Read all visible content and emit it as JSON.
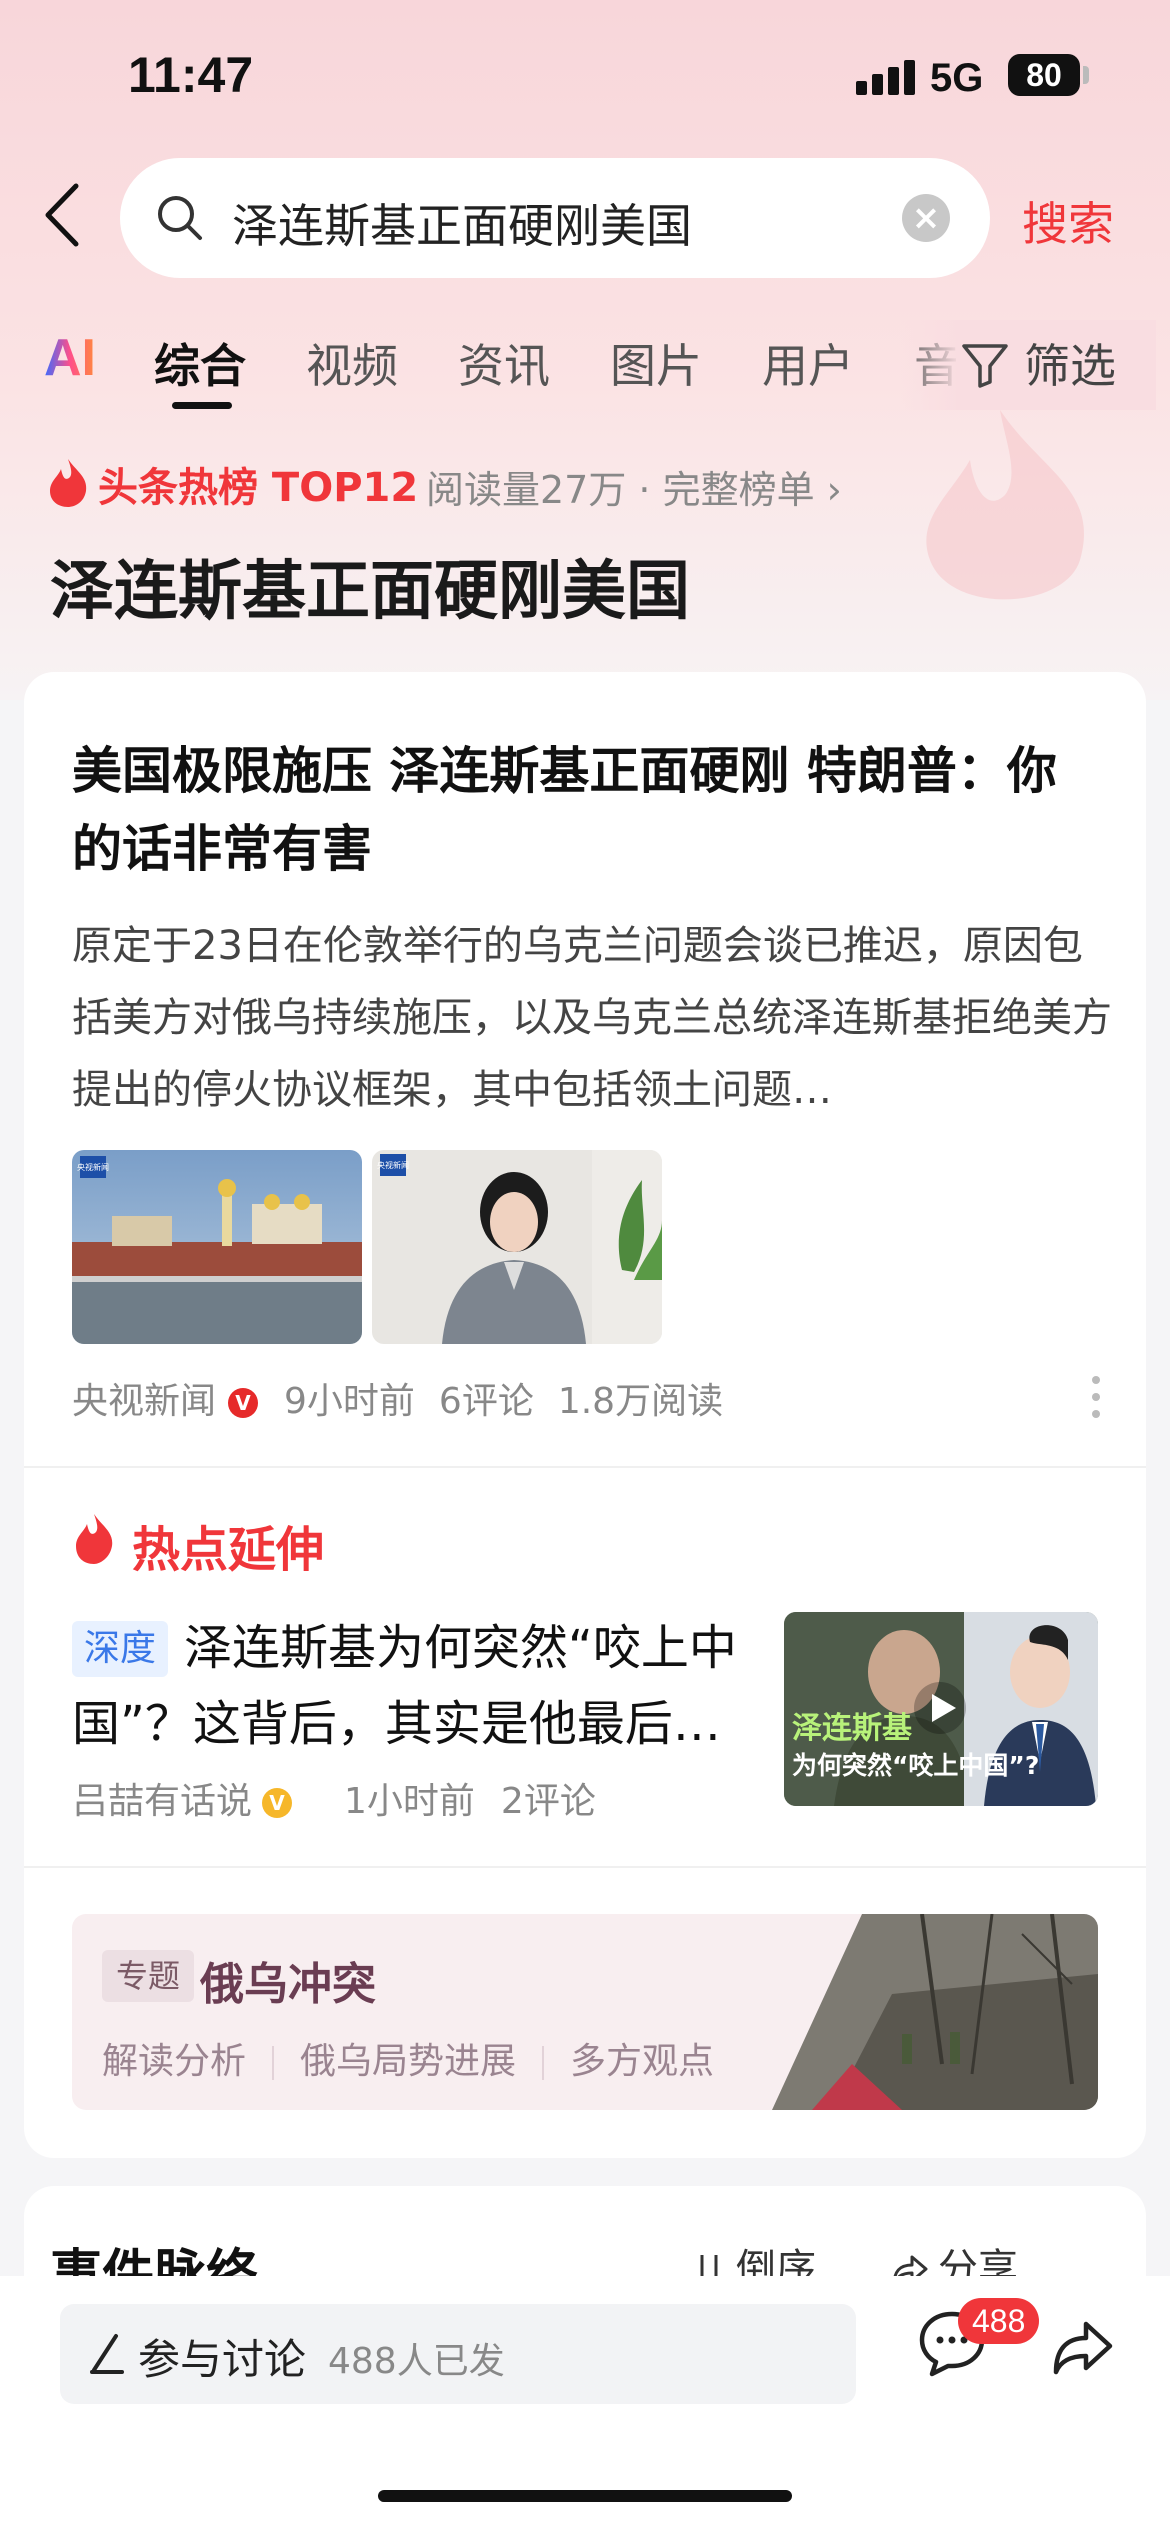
{
  "status_bar": {
    "time": "11:47",
    "network": "5G",
    "battery": "80"
  },
  "search": {
    "query": "泽连斯基正面硬刚美国",
    "button_label": "搜索"
  },
  "tabs": {
    "ai_label": "AI",
    "items": [
      {
        "label": "综合"
      },
      {
        "label": "视频"
      },
      {
        "label": "资讯"
      },
      {
        "label": "图片"
      },
      {
        "label": "用户"
      },
      {
        "label": "音"
      }
    ],
    "filter_label": "筛选"
  },
  "hot": {
    "badge": "头条热榜 TOP12",
    "meta": "阅读量27万 · 完整榜单 ›",
    "topic": "泽连斯基正面硬刚美国"
  },
  "article": {
    "title": "美国极限施压 泽连斯基正面硬刚 特朗普：你的话非常有害",
    "summary": "原定于23日在伦敦举行的乌克兰问题会谈已推迟，原因包括美方对俄乌持续施压，以及乌克兰总统泽连斯基拒绝美方提出的停火协议框架，其中包括领土问题…",
    "source": "央视新闻",
    "verified_mark": "V",
    "time": "9小时前",
    "comments": "6评论",
    "reads": "1.8万阅读",
    "thumb_logo": "央视新闻"
  },
  "extension": {
    "title": "热点延伸",
    "item": {
      "tag": "深度",
      "title": "泽连斯基为何突然“咬上中国”？这背后，其实是他最后…",
      "author": "吕喆有话说",
      "verified_mark": "V",
      "time": "1小时前",
      "comments": "2评论",
      "thumb_text_1": "泽连斯基",
      "thumb_text_2": "为何突然“咬上中国”?"
    }
  },
  "special": {
    "tag": "专题",
    "name": "俄乌冲突",
    "links": [
      "解读分析",
      "俄乌局势进展",
      "多方观点"
    ]
  },
  "timeline": {
    "title": "事件脉络",
    "sort_label": "倒序",
    "share_label": "分享"
  },
  "bottom": {
    "discuss_label": "参与讨论",
    "discuss_count": "488人已发",
    "comment_badge": "488"
  }
}
